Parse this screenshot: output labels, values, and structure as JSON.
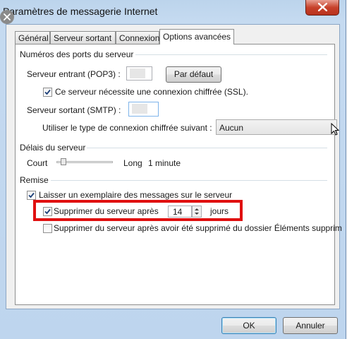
{
  "window": {
    "title": "Paramètres de messagerie Internet"
  },
  "tabs": [
    {
      "label": "Général"
    },
    {
      "label": "Serveur sortant"
    },
    {
      "label": "Connexion"
    },
    {
      "label": "Options avancées"
    }
  ],
  "ports": {
    "group_label": "Numéros des ports du serveur",
    "incoming_label": "Serveur entrant (POP3) :",
    "incoming_value": "",
    "default_button": "Par défaut",
    "ssl_label": "Ce serveur nécessite une connexion chiffrée (SSL).",
    "ssl_checked": true,
    "outgoing_label": "Serveur sortant (SMTP) :",
    "outgoing_value": "",
    "encryption_label": "Utiliser le type de connexion chiffrée suivant :",
    "encryption_value": "Aucun"
  },
  "timeout": {
    "group_label": "Délais du serveur",
    "short_label": "Court",
    "long_label": "Long",
    "value_label": "1 minute"
  },
  "delivery": {
    "group_label": "Remise",
    "leave_copy_label": "Laisser un exemplaire des messages sur le serveur",
    "leave_copy_checked": true,
    "remove_after_label": "Supprimer du serveur après",
    "remove_after_checked": true,
    "days_value": "14",
    "days_label": "jours",
    "remove_deleted_label": "Supprimer du serveur après avoir été supprimé du dossier Éléments supprim",
    "remove_deleted_checked": false
  },
  "footer": {
    "ok_label": "OK",
    "cancel_label": "Annuler"
  },
  "colors": {
    "highlight": "#e01010",
    "window_frame": "#c5daf0"
  }
}
